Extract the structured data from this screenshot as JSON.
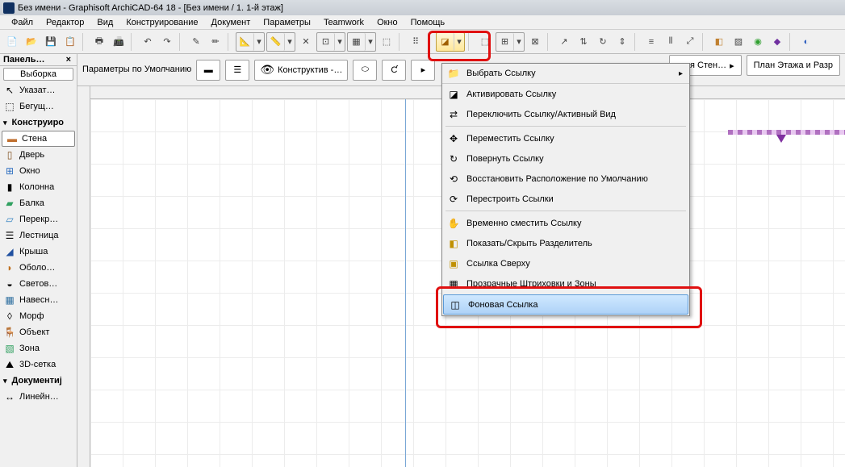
{
  "title": "Без имени - Graphisoft ArchiCAD-64 18 - [Без имени / 1. 1-й этаж]",
  "menu": [
    "Файл",
    "Редактор",
    "Вид",
    "Конструирование",
    "Документ",
    "Параметры",
    "Teamwork",
    "Окно",
    "Помощь"
  ],
  "panel_header": "Панель…",
  "selection_btn": "Выборка",
  "tools": {
    "pointer": "Указат…",
    "marquee": "Бегущ…",
    "section_construct": "Конструиро",
    "wall": "Стена",
    "door": "Дверь",
    "window": "Окно",
    "column": "Колонна",
    "beam": "Балка",
    "slab": "Перекр…",
    "stair": "Лестница",
    "roof": "Крыша",
    "shell": "Оболо…",
    "light": "Светов…",
    "curtain": "Навесн…",
    "morph": "Морф",
    "object": "Объект",
    "zone": "Зона",
    "mesh": "3D-сетка",
    "section_document": "Документиј",
    "linear": "Линейн…"
  },
  "infobar": {
    "defaults": "Параметры по Умолчанию",
    "view_label": "Конструктив -…"
  },
  "right_buttons": {
    "wall": "…ая Стен…",
    "plan": "План Этажа и Разр"
  },
  "dropdown": {
    "header": "Выбрать Ссылку",
    "items": [
      "Активировать Ссылку",
      "Переключить Ссылку/Активный Вид",
      "Переместить Ссылку",
      "Повернуть Ссылку",
      "Восстановить Расположение по Умолчанию",
      "Перестроить Ссылки",
      "Временно сместить Ссылку",
      "Показать/Скрыть Разделитель",
      "Ссылка Сверху",
      "Прозрачные Штриховки и Зоны",
      "Фоновая Ссылка"
    ]
  }
}
